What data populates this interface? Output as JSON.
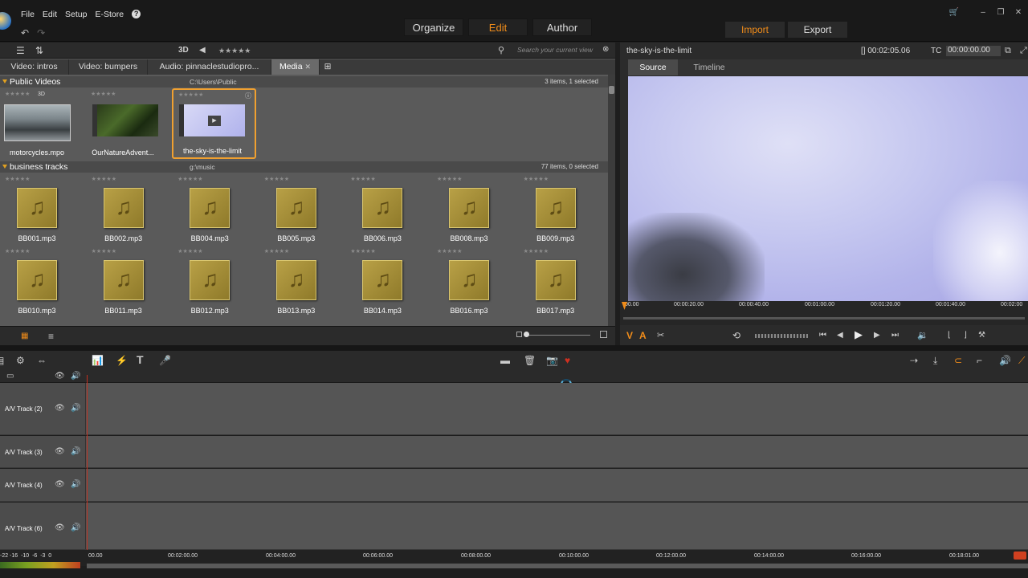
{
  "menu": [
    "File",
    "Edit",
    "Setup",
    "E-Store"
  ],
  "modes": {
    "organize": "Organize",
    "edit": "Edit",
    "author": "Author"
  },
  "actions": {
    "import": "Import",
    "export": "Export"
  },
  "library": {
    "toolbar_3d": "3D",
    "stars": "★★★★★",
    "search_placeholder": "Search your current view",
    "tabs": [
      "Video: intros",
      "Video: bumpers",
      "Audio: pinnaclestudiopro...",
      "Media"
    ],
    "section1": {
      "title": "Public Videos",
      "path": "C:\\Users\\Public",
      "count": "3 items, 1 selected"
    },
    "videos": [
      {
        "name": "motorcycles.mpo",
        "badge": "3D"
      },
      {
        "name": "OurNatureAdvent..."
      },
      {
        "name": "the-sky-is-the-limit"
      }
    ],
    "section2": {
      "title": "business tracks",
      "path": "g:\\music",
      "count": "77 items, 0 selected"
    },
    "tracks_row1": [
      "BB001.mp3",
      "BB002.mp3",
      "BB004.mp3",
      "BB005.mp3",
      "BB006.mp3",
      "BB008.mp3",
      "BB009.mp3"
    ],
    "tracks_row2": [
      "BB010.mp3",
      "BB011.mp3",
      "BB012.mp3",
      "BB013.mp3",
      "BB014.mp3",
      "BB016.mp3",
      "BB017.mp3"
    ]
  },
  "player": {
    "title": "the-sky-is-the-limit",
    "duration": "00:02:05.06",
    "tc_label": "TC",
    "tc_value": "00:00:00.00",
    "tabs": [
      "Source",
      "Timeline"
    ],
    "ruler": [
      "00.00",
      "00:00:20.00",
      "00:00:40.00",
      "00:01:00.00",
      "00:01:20.00",
      "00:01:40.00",
      "00:02:00"
    ]
  },
  "timeline": {
    "tracks": [
      "A/V Track (2)",
      "A/V Track (3)",
      "A/V Track (4)",
      "A/V Track (6)"
    ],
    "ruler": [
      "00.00",
      "00:02:00.00",
      "00:04:00.00",
      "00:06:00.00",
      "00:08:00.00",
      "00:10:00.00",
      "00:12:00.00",
      "00:14:00.00",
      "00:16:00.00",
      "00:18:01.00"
    ],
    "meter_labels": "-22 -16  -10  -6  -3  0"
  },
  "colors": {
    "accent": "#f08c1a",
    "selection": "#f0a030"
  }
}
